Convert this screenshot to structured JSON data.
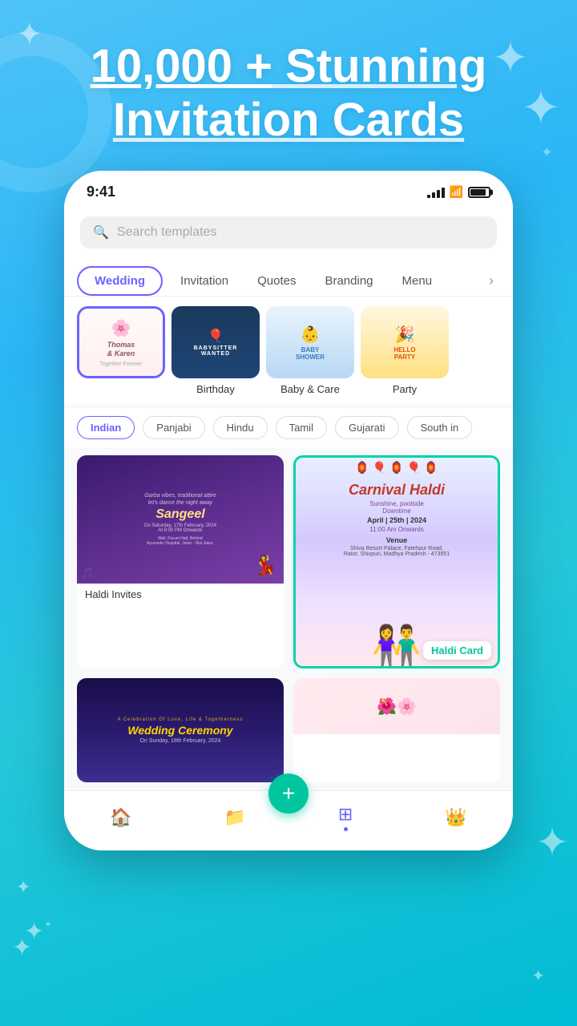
{
  "app": {
    "background_gradient": "linear-gradient(160deg, #4fc3f7 0%, #29b6f6 30%, #26c6da 60%, #00bcd4 100%)"
  },
  "hero": {
    "title_line1": "10,000 + Stunning",
    "title_line2": "Invitation Cards",
    "underline_word": "10,000 +"
  },
  "status_bar": {
    "time": "9:41",
    "signal": "signal-icon",
    "wifi": "wifi-icon",
    "battery": "battery-icon"
  },
  "search": {
    "placeholder": "Search templates"
  },
  "tabs": [
    {
      "label": "Wedding",
      "active": true
    },
    {
      "label": "Invitation",
      "active": false
    },
    {
      "label": "Quotes",
      "active": false
    },
    {
      "label": "Branding",
      "active": false
    },
    {
      "label": "Menu",
      "active": false
    }
  ],
  "categories": [
    {
      "label": "",
      "icon": "💐",
      "selected": true
    },
    {
      "label": "Birthday",
      "icon": "🎂",
      "selected": false
    },
    {
      "label": "Baby & Care",
      "icon": "👶",
      "selected": false
    },
    {
      "label": "Party",
      "icon": "🎉",
      "selected": false
    }
  ],
  "filters": [
    {
      "label": "Indian",
      "active": true
    },
    {
      "label": "Panjabi",
      "active": false
    },
    {
      "label": "Hindu",
      "active": false
    },
    {
      "label": "Tamil",
      "active": false
    },
    {
      "label": "Gujarati",
      "active": false
    },
    {
      "label": "South in",
      "active": false
    }
  ],
  "cards": [
    {
      "id": "haldi-invites",
      "label": "Haldi Invites",
      "type": "haldi",
      "highlighted": false,
      "badge": null,
      "event_name": "Sangeel",
      "text1": "Garba vibes, traditional attire",
      "text2": "let's dance the night away",
      "date_text": "On Saturday, 17th February, 2024",
      "time_text": "At 8:00 PM Onwards",
      "venue_text": "Mall, Puruni Hatt, Behind Ayurvedic Hospital, Jalun - Dist Jalun."
    },
    {
      "id": "haldi-card",
      "label": "Haldi Card",
      "type": "carnival",
      "highlighted": true,
      "badge": "Haldi Card",
      "title": "Carnival Haldi",
      "sub1": "Sunshine, poolside",
      "sub2": "Downtime",
      "date": "April | 25th | 2024",
      "time": "11:00 Am Onwards",
      "venue_label": "Venue",
      "venue": "Shiva Resort Palace, Fatehpur Road, Rator, Shivpuri, Madhya Pradesh - 473551"
    },
    {
      "id": "wedding-ceremony",
      "label": "",
      "type": "wedding2",
      "highlighted": false,
      "badge": null,
      "text1": "A Celebration Of Love, Life & Togetherness",
      "title": "Wedding Ceremony",
      "date": "On Sunday, 18th February, 2024"
    },
    {
      "id": "bottom-partial",
      "label": "",
      "type": "partial",
      "highlighted": false,
      "badge": null
    }
  ],
  "bottom_nav": [
    {
      "icon": "🏠",
      "label": "home",
      "active": false
    },
    {
      "icon": "📁",
      "label": "folder",
      "active": false
    },
    {
      "icon": "⊞",
      "label": "grid",
      "active": true
    },
    {
      "icon": "👑",
      "label": "crown",
      "active": false
    }
  ],
  "fab": {
    "icon": "+"
  }
}
